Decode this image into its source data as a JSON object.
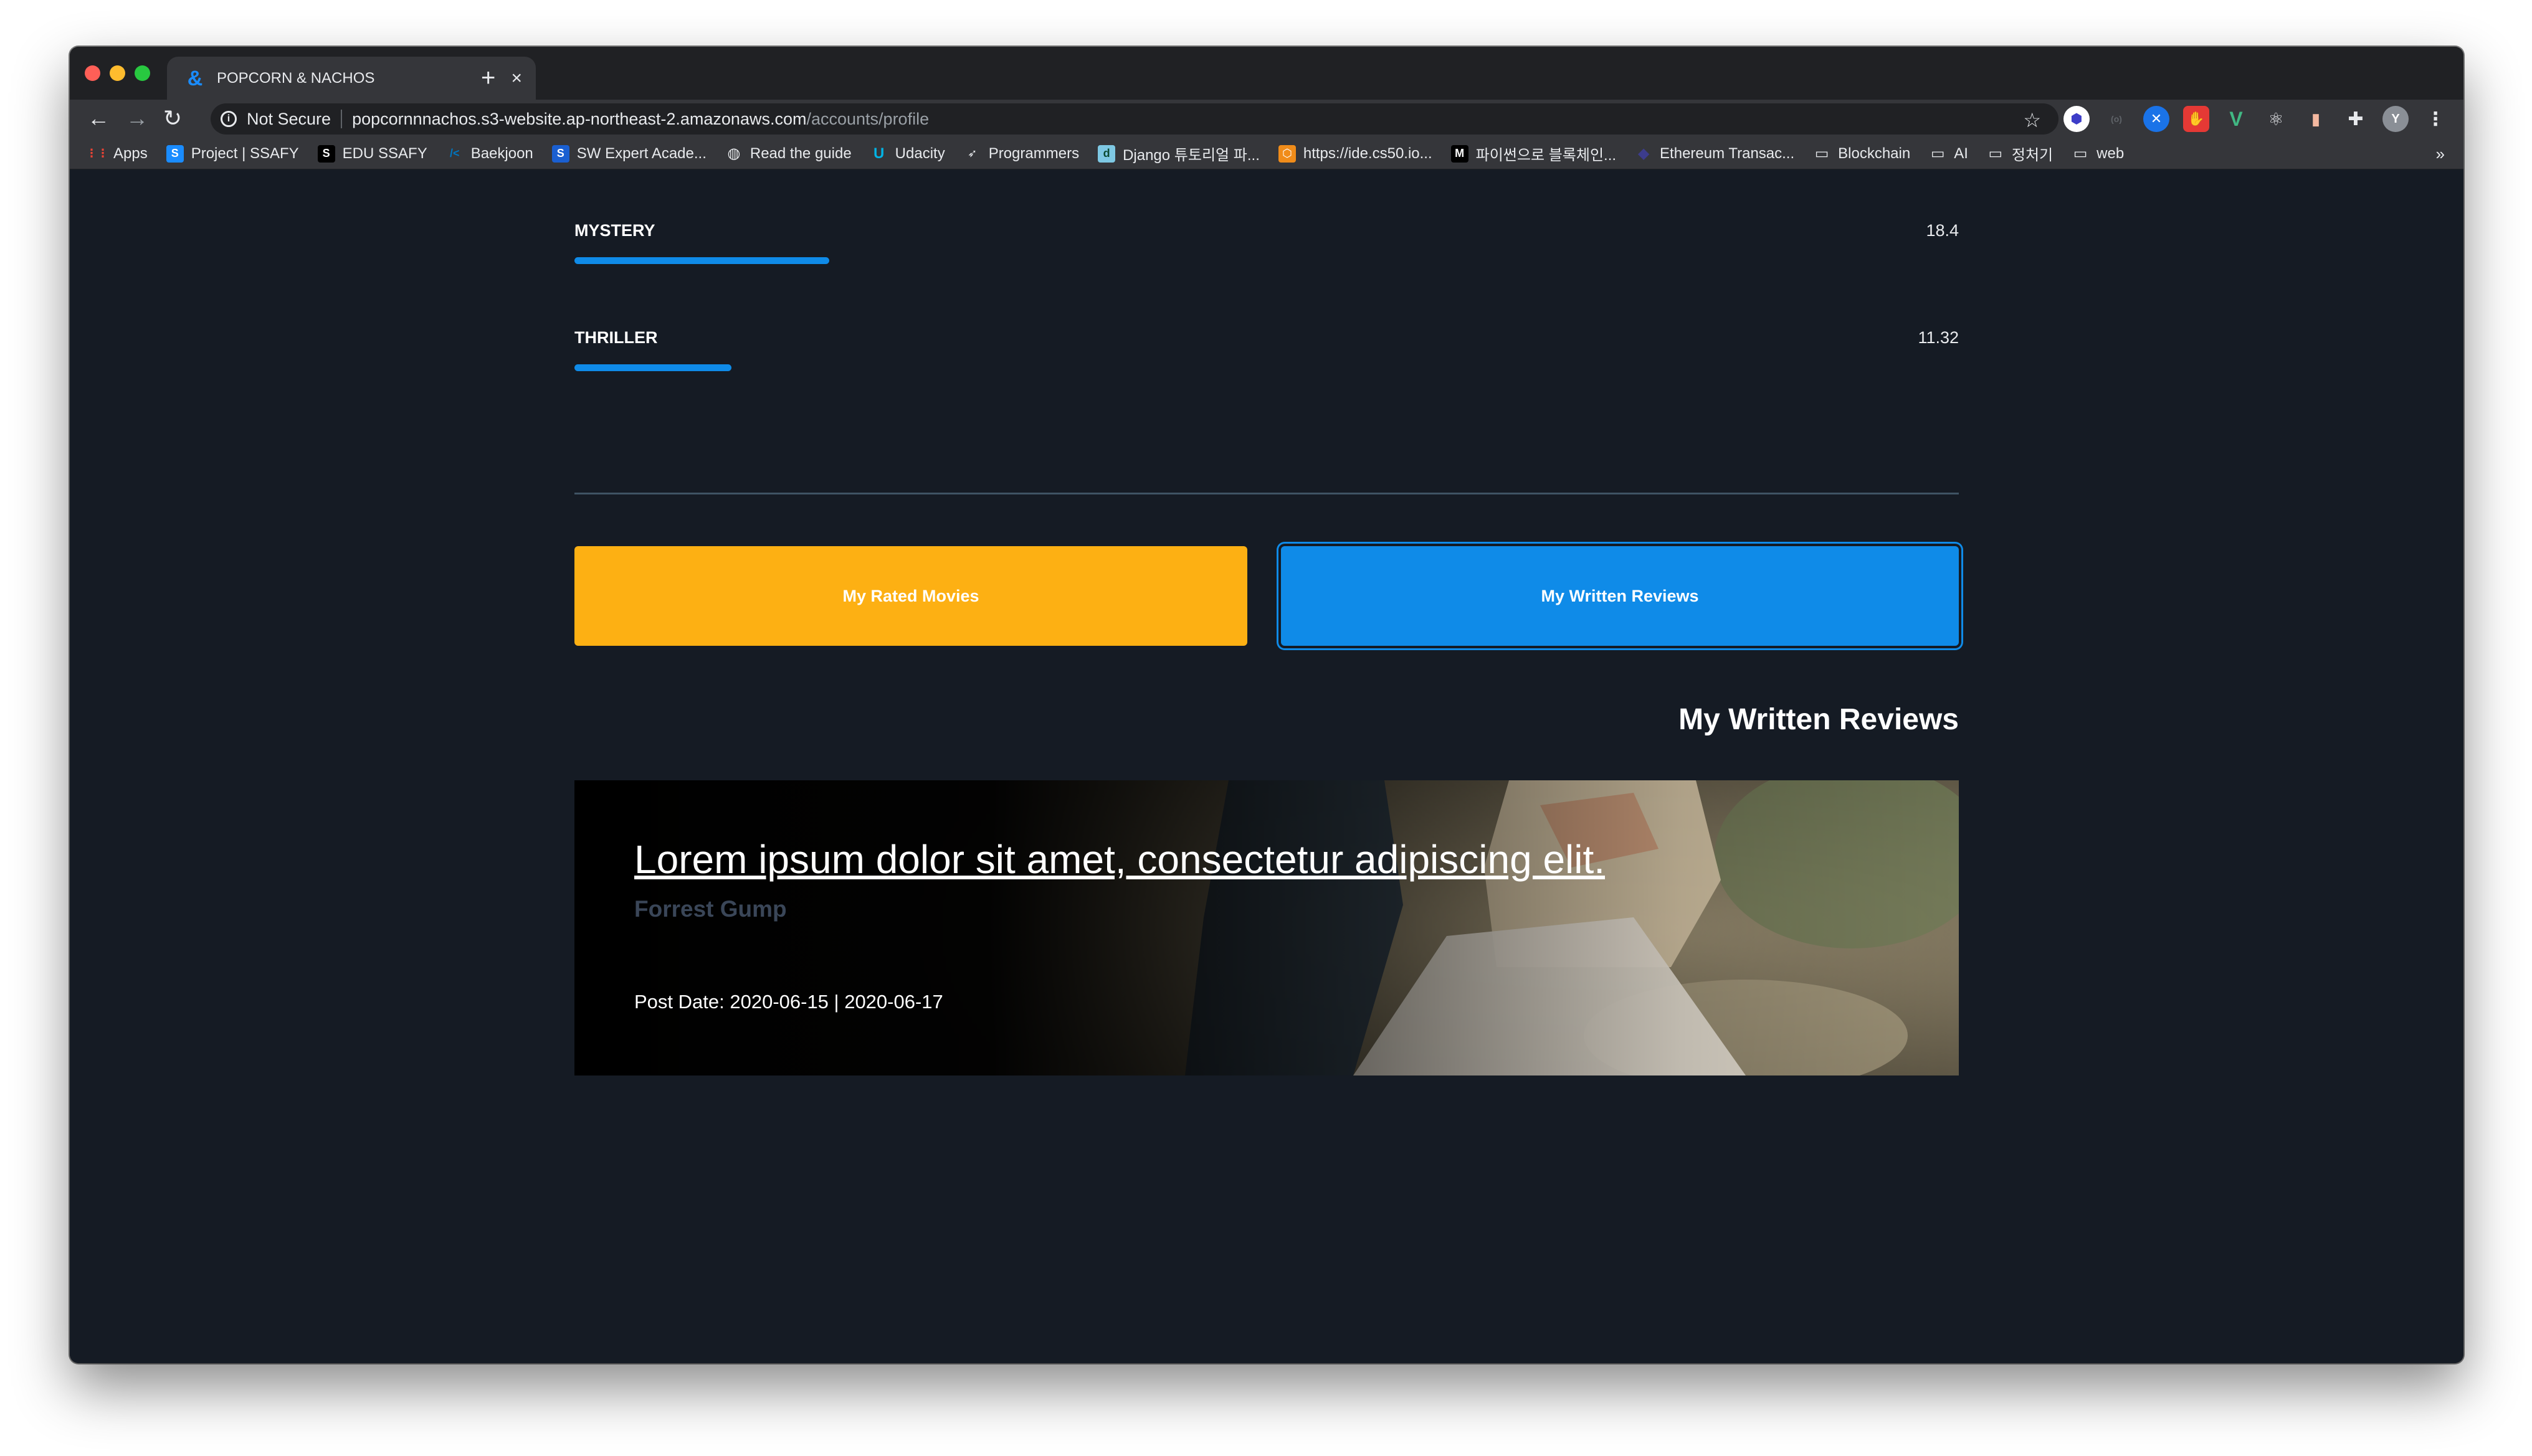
{
  "browser": {
    "tab_title": "POPCORN & NACHOS",
    "tab_favicon": "&",
    "new_tab": "+",
    "close": "×",
    "security_label": "Not Secure",
    "url_host": "popcornnnachos.s3-website.ap-northeast-2.amazonaws.com",
    "url_path": "/accounts/profile",
    "bookmarks": [
      {
        "label": "Apps",
        "icon": "apps-grid-icon"
      },
      {
        "label": "Project | SSAFY",
        "icon": "ssafy-icon"
      },
      {
        "label": "EDU SSAFY",
        "icon": "edu-ssafy-icon"
      },
      {
        "label": "Baekjoon",
        "icon": "baekjoon-icon"
      },
      {
        "label": "SW Expert Acade...",
        "icon": "swea-icon"
      },
      {
        "label": "Read the guide",
        "icon": "globe-icon"
      },
      {
        "label": "Udacity",
        "icon": "udacity-icon"
      },
      {
        "label": "Programmers",
        "icon": "programmers-icon"
      },
      {
        "label": "Django 튜토리얼 파...",
        "icon": "django-icon"
      },
      {
        "label": "https://ide.cs50.io...",
        "icon": "cs50-icon"
      },
      {
        "label": "파이썬으로 블록체인...",
        "icon": "medium-icon"
      },
      {
        "label": "Ethereum Transac...",
        "icon": "ethereum-icon"
      },
      {
        "label": "Blockchain",
        "icon": "folder-icon"
      },
      {
        "label": "AI",
        "icon": "folder-icon"
      },
      {
        "label": "정처기",
        "icon": "folder-icon"
      },
      {
        "label": "web",
        "icon": "folder-icon"
      }
    ],
    "bookmarks_more": "»",
    "profile_initial": "Y"
  },
  "profile": {
    "genres": [
      {
        "name": "MYSTERY",
        "value": "18.4",
        "bar_fraction": 0.184
      },
      {
        "name": "THRILLER",
        "value": "11.32",
        "bar_fraction": 0.1132
      }
    ],
    "buttons": {
      "rated": "My Rated Movies",
      "written": "My Written Reviews"
    },
    "section_title": "My Written Reviews",
    "reviews": [
      {
        "title": "Lorem ipsum dolor sit amet, consectetur adipiscing elit.",
        "movie": "Forrest Gump",
        "post_date": "Post Date: 2020-06-15 | 2020-06-17"
      }
    ]
  },
  "colors": {
    "page_bg": "#151b24",
    "accent_blue": "#0f8be8",
    "accent_yellow": "#fdb013"
  }
}
